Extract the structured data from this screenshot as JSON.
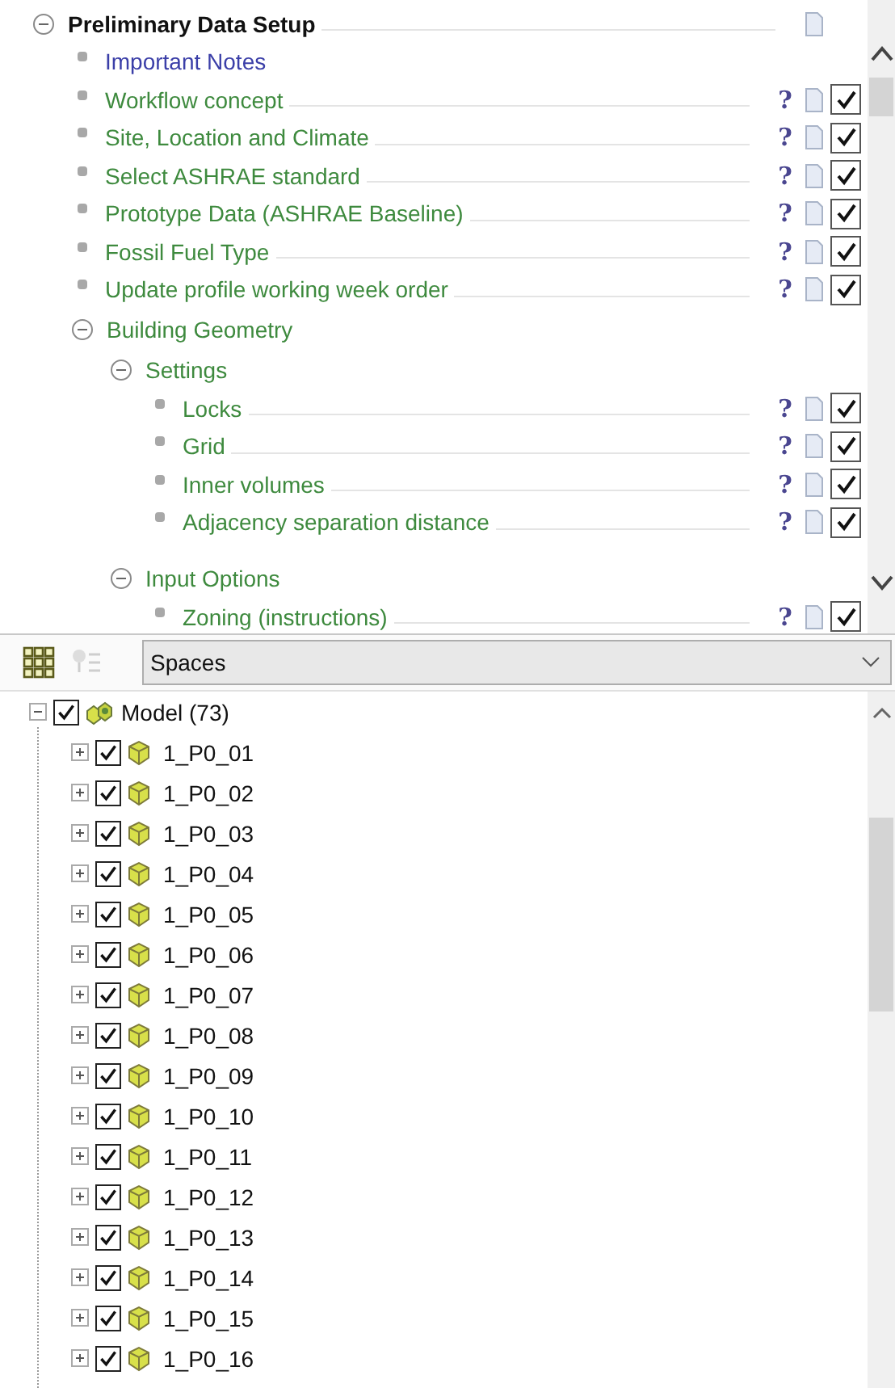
{
  "outline": {
    "title": "Preliminary Data Setup",
    "expanded": true,
    "items": [
      {
        "kind": "link",
        "label": "Important Notes"
      },
      {
        "kind": "topic",
        "label": "Workflow concept",
        "help": "?",
        "checked": true
      },
      {
        "kind": "topic",
        "label": "Site, Location and Climate",
        "help": "?",
        "checked": true
      },
      {
        "kind": "topic",
        "label": "Select ASHRAE standard",
        "help": "?",
        "checked": true
      },
      {
        "kind": "topic",
        "label": "Prototype Data (ASHRAE Baseline)",
        "help": "?",
        "checked": true
      },
      {
        "kind": "topic",
        "label": "Fossil Fuel Type",
        "help": "?",
        "checked": true
      },
      {
        "kind": "topic",
        "label": "Update profile working week order",
        "help": "?",
        "checked": true
      },
      {
        "kind": "group",
        "label": "Building Geometry",
        "expanded": true,
        "children": [
          {
            "kind": "group",
            "label": "Settings",
            "expanded": true,
            "children": [
              {
                "kind": "topic",
                "label": "Locks",
                "help": "?",
                "checked": true
              },
              {
                "kind": "topic",
                "label": "Grid",
                "help": "?",
                "checked": true
              },
              {
                "kind": "topic",
                "label": "Inner volumes",
                "help": "?",
                "checked": true
              },
              {
                "kind": "topic",
                "label": "Adjacency separation distance",
                "help": "?",
                "checked": true
              }
            ]
          },
          {
            "kind": "group",
            "label": "Input Options",
            "expanded": true,
            "children": [
              {
                "kind": "topic",
                "label": "Zoning (instructions)",
                "help": "?",
                "checked": true
              }
            ]
          }
        ]
      }
    ]
  },
  "toolbar": {
    "view_select": {
      "value": "Spaces"
    }
  },
  "tree": {
    "label": "Model (73)",
    "checked": true,
    "expanded": true,
    "children": [
      {
        "label": "1_P0_01",
        "checked": true,
        "expanded": false
      },
      {
        "label": "1_P0_02",
        "checked": true,
        "expanded": false
      },
      {
        "label": "1_P0_03",
        "checked": true,
        "expanded": false
      },
      {
        "label": "1_P0_04",
        "checked": true,
        "expanded": false
      },
      {
        "label": "1_P0_05",
        "checked": true,
        "expanded": false
      },
      {
        "label": "1_P0_06",
        "checked": true,
        "expanded": false
      },
      {
        "label": "1_P0_07",
        "checked": true,
        "expanded": false
      },
      {
        "label": "1_P0_08",
        "checked": true,
        "expanded": false
      },
      {
        "label": "1_P0_09",
        "checked": true,
        "expanded": false
      },
      {
        "label": "1_P0_10",
        "checked": true,
        "expanded": false
      },
      {
        "label": "1_P0_11",
        "checked": true,
        "expanded": false
      },
      {
        "label": "1_P0_12",
        "checked": true,
        "expanded": false
      },
      {
        "label": "1_P0_13",
        "checked": true,
        "expanded": false
      },
      {
        "label": "1_P0_14",
        "checked": true,
        "expanded": false
      },
      {
        "label": "1_P0_15",
        "checked": true,
        "expanded": false
      },
      {
        "label": "1_P0_16",
        "checked": true,
        "expanded": false
      }
    ]
  }
}
